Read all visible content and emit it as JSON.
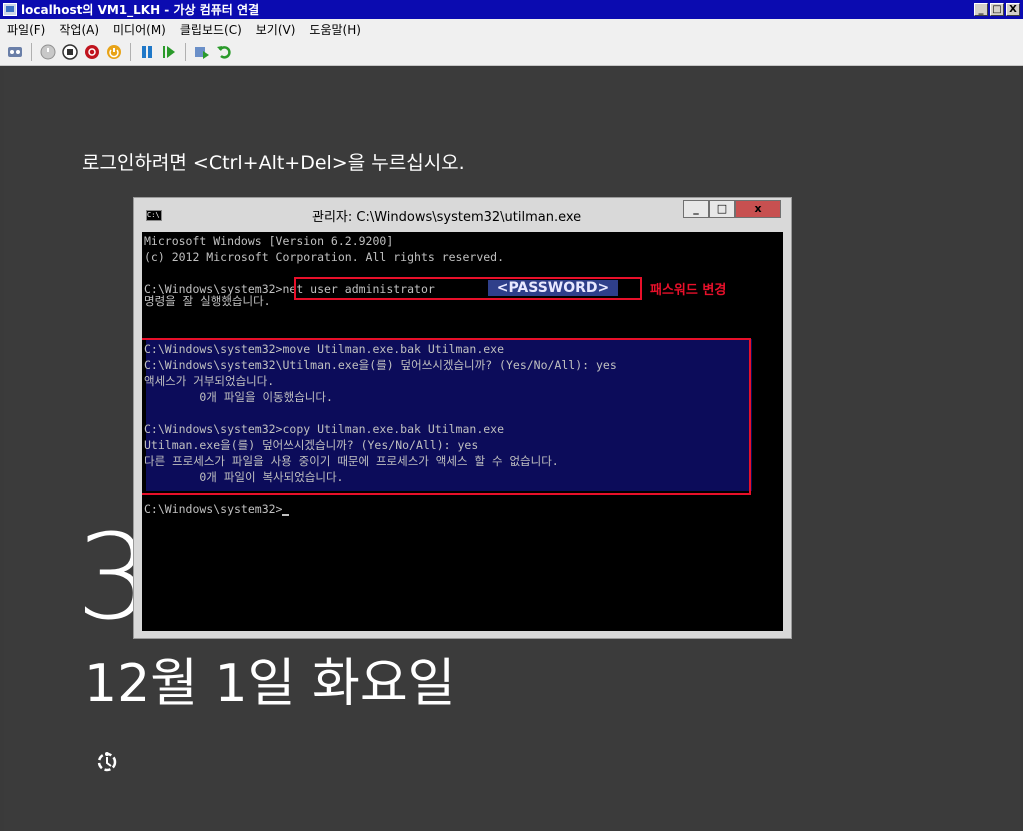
{
  "window": {
    "title": "localhost의 VM1_LKH - 가상 컴퓨터 연결",
    "buttons": [
      "_",
      "□",
      "X"
    ]
  },
  "menu": [
    "파일(F)",
    "작업(A)",
    "미디어(M)",
    "클립보드(C)",
    "보기(V)",
    "도움말(H)"
  ],
  "toolbar_icons": [
    "ctrl-alt-del-icon",
    "start-icon",
    "turn-off-icon",
    "shutdown-icon",
    "power-reset-icon",
    "pause-icon",
    "resume-icon",
    "snapshot-icon",
    "revert-icon"
  ],
  "guest": {
    "login_hint": "로그인하려면 <Ctrl+Alt+Del>을 누르십시오.",
    "clock_partial": "3",
    "date": "12월 1일 화요일"
  },
  "cmd": {
    "title": "관리자: C:\\Windows\\system32\\utilman.exe",
    "lines": [
      "Microsoft Windows [Version 6.2.9200]",
      "(c) 2012 Microsoft Corporation. All rights reserved.",
      "",
      "C:\\Windows\\system32>net user administrator",
      "명령을 잘 실행했습니다.",
      "",
      "",
      "C:\\Windows\\system32>move Utilman.exe.bak Utilman.exe",
      "C:\\Windows\\system32\\Utilman.exe을(를) 덮어쓰시겠습니까? (Yes/No/All): yes",
      "액세스가 거부되었습니다.",
      "        0개 파일을 이동했습니다.",
      "",
      "C:\\Windows\\system32>copy Utilman.exe.bak Utilman.exe",
      "Utilman.exe을(를) 덮어쓰시겠습니까? (Yes/No/All): yes",
      "다른 프로세스가 파일을 사용 중이기 때문에 프로세스가 액세스 할 수 없습니다.",
      "        0개 파일이 복사되었습니다.",
      "",
      "C:\\Windows\\system32>"
    ],
    "password_mask": "<PASSWORD>",
    "annotation": "패스워드 변경"
  }
}
